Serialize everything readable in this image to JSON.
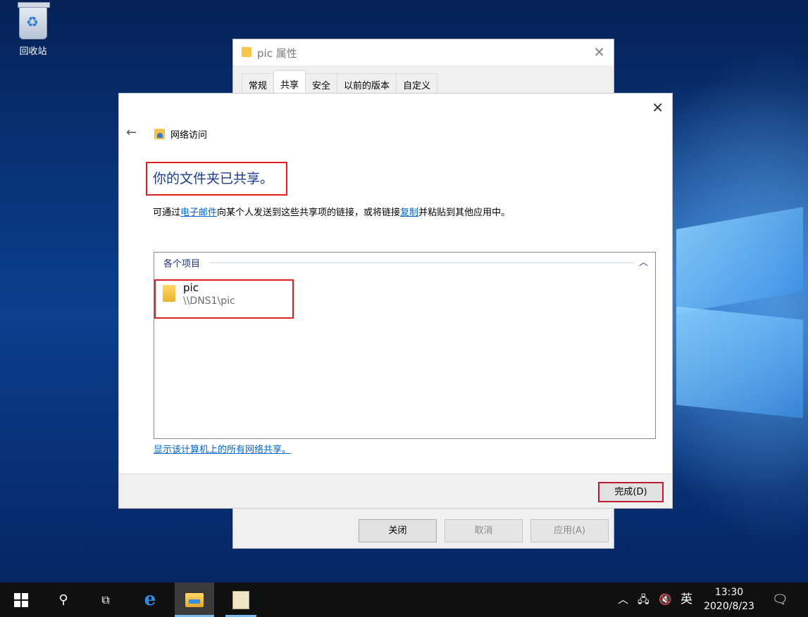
{
  "desktop": {
    "recycle_bin_label": "回收站"
  },
  "properties_window": {
    "title": "pic 属性",
    "tabs": [
      {
        "label": "常规"
      },
      {
        "label": "共享",
        "active": true
      },
      {
        "label": "安全"
      },
      {
        "label": "以前的版本"
      },
      {
        "label": "自定义"
      }
    ],
    "buttons": {
      "close": "关闭",
      "cancel": "取消",
      "apply": "应用(A)"
    }
  },
  "network_dialog": {
    "breadcrumb": "网络访问",
    "heading": "你的文件夹已共享。",
    "desc_prefix": "可通过",
    "desc_email_link": "电子邮件",
    "desc_middle": "向某个人发送到这些共享项的链接，或将链接",
    "desc_copy_link": "复制",
    "desc_suffix": "并粘贴到其他应用中。",
    "group_header": "各个项目",
    "items": [
      {
        "name": "pic",
        "path": "\\\\DNS1\\pic"
      }
    ],
    "show_all_link": "显示该计算机上的所有网络共享。",
    "finish_button": "完成(D)"
  },
  "taskbar": {
    "language": "英",
    "time": "13:30",
    "date": "2020/8/23"
  },
  "colors": {
    "heading": "#1a3b8e",
    "link": "#0066cc",
    "highlight_box": "#e02020",
    "taskbar": "#101010"
  }
}
